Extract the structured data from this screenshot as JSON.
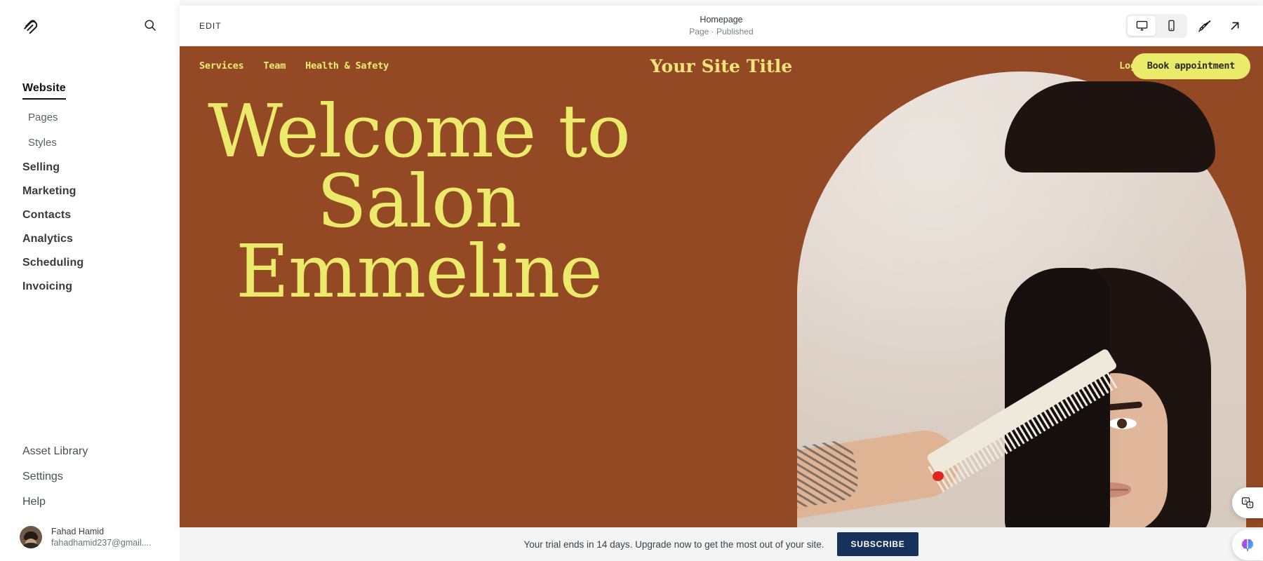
{
  "sidebar": {
    "logo_icon": "squarespace-logo",
    "search_icon": "search-icon",
    "primary": [
      {
        "label": "Website",
        "active": true
      },
      {
        "label": "Selling",
        "active": false
      },
      {
        "label": "Marketing",
        "active": false
      },
      {
        "label": "Contacts",
        "active": false
      },
      {
        "label": "Analytics",
        "active": false
      },
      {
        "label": "Scheduling",
        "active": false
      },
      {
        "label": "Invoicing",
        "active": false
      }
    ],
    "website_sub": [
      {
        "label": "Pages"
      },
      {
        "label": "Styles"
      }
    ],
    "bottom": [
      {
        "label": "Asset Library"
      },
      {
        "label": "Settings"
      },
      {
        "label": "Help"
      }
    ],
    "user": {
      "name": "Fahad Hamid",
      "email": "fahadhamid237@gmail....",
      "avatar_icon": "avatar"
    }
  },
  "toolbar": {
    "edit_label": "EDIT",
    "page_title": "Homepage",
    "page_status": "Page · Published",
    "device_desktop_icon": "desktop-monitor-icon",
    "device_mobile_icon": "mobile-phone-icon",
    "device_selected": "desktop",
    "paintbrush_icon": "paintbrush-icon",
    "open_external_icon": "arrow-up-right-icon"
  },
  "site": {
    "nav": [
      {
        "label": "Services"
      },
      {
        "label": "Team"
      },
      {
        "label": "Health & Safety"
      }
    ],
    "title": "Your Site Title",
    "login_label": "Login",
    "book_label": "Book appointment",
    "hero_heading": "Welcome to Salon Emmeline",
    "image_alt": "woman having hair combed in front of arch",
    "colors": {
      "background_brown": "#934a24",
      "accent_yellow": "#ecea6a",
      "button_yellow": "#eaeb6a",
      "arch_beige": "#ded2c8"
    }
  },
  "trial_banner": {
    "message": "Your trial ends in 14 days. Upgrade now to get the most out of your site.",
    "subscribe_label": "SUBSCRIBE"
  },
  "floating": {
    "translate_icon": "translate-icon",
    "ai_assistant_icon": "brain-ai-icon"
  }
}
